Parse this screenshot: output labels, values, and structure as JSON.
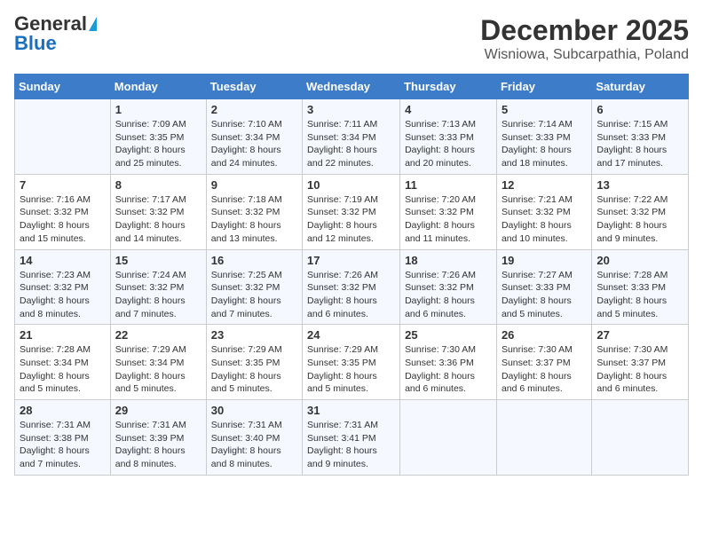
{
  "logo": {
    "line1": "General",
    "line2": "Blue"
  },
  "title": "December 2025",
  "subtitle": "Wisniowa, Subcarpathia, Poland",
  "days_of_week": [
    "Sunday",
    "Monday",
    "Tuesday",
    "Wednesday",
    "Thursday",
    "Friday",
    "Saturday"
  ],
  "weeks": [
    [
      {
        "day": "",
        "info": ""
      },
      {
        "day": "1",
        "info": "Sunrise: 7:09 AM\nSunset: 3:35 PM\nDaylight: 8 hours\nand 25 minutes."
      },
      {
        "day": "2",
        "info": "Sunrise: 7:10 AM\nSunset: 3:34 PM\nDaylight: 8 hours\nand 24 minutes."
      },
      {
        "day": "3",
        "info": "Sunrise: 7:11 AM\nSunset: 3:34 PM\nDaylight: 8 hours\nand 22 minutes."
      },
      {
        "day": "4",
        "info": "Sunrise: 7:13 AM\nSunset: 3:33 PM\nDaylight: 8 hours\nand 20 minutes."
      },
      {
        "day": "5",
        "info": "Sunrise: 7:14 AM\nSunset: 3:33 PM\nDaylight: 8 hours\nand 18 minutes."
      },
      {
        "day": "6",
        "info": "Sunrise: 7:15 AM\nSunset: 3:33 PM\nDaylight: 8 hours\nand 17 minutes."
      }
    ],
    [
      {
        "day": "7",
        "info": "Sunrise: 7:16 AM\nSunset: 3:32 PM\nDaylight: 8 hours\nand 15 minutes."
      },
      {
        "day": "8",
        "info": "Sunrise: 7:17 AM\nSunset: 3:32 PM\nDaylight: 8 hours\nand 14 minutes."
      },
      {
        "day": "9",
        "info": "Sunrise: 7:18 AM\nSunset: 3:32 PM\nDaylight: 8 hours\nand 13 minutes."
      },
      {
        "day": "10",
        "info": "Sunrise: 7:19 AM\nSunset: 3:32 PM\nDaylight: 8 hours\nand 12 minutes."
      },
      {
        "day": "11",
        "info": "Sunrise: 7:20 AM\nSunset: 3:32 PM\nDaylight: 8 hours\nand 11 minutes."
      },
      {
        "day": "12",
        "info": "Sunrise: 7:21 AM\nSunset: 3:32 PM\nDaylight: 8 hours\nand 10 minutes."
      },
      {
        "day": "13",
        "info": "Sunrise: 7:22 AM\nSunset: 3:32 PM\nDaylight: 8 hours\nand 9 minutes."
      }
    ],
    [
      {
        "day": "14",
        "info": "Sunrise: 7:23 AM\nSunset: 3:32 PM\nDaylight: 8 hours\nand 8 minutes."
      },
      {
        "day": "15",
        "info": "Sunrise: 7:24 AM\nSunset: 3:32 PM\nDaylight: 8 hours\nand 7 minutes."
      },
      {
        "day": "16",
        "info": "Sunrise: 7:25 AM\nSunset: 3:32 PM\nDaylight: 8 hours\nand 7 minutes."
      },
      {
        "day": "17",
        "info": "Sunrise: 7:26 AM\nSunset: 3:32 PM\nDaylight: 8 hours\nand 6 minutes."
      },
      {
        "day": "18",
        "info": "Sunrise: 7:26 AM\nSunset: 3:32 PM\nDaylight: 8 hours\nand 6 minutes."
      },
      {
        "day": "19",
        "info": "Sunrise: 7:27 AM\nSunset: 3:33 PM\nDaylight: 8 hours\nand 5 minutes."
      },
      {
        "day": "20",
        "info": "Sunrise: 7:28 AM\nSunset: 3:33 PM\nDaylight: 8 hours\nand 5 minutes."
      }
    ],
    [
      {
        "day": "21",
        "info": "Sunrise: 7:28 AM\nSunset: 3:34 PM\nDaylight: 8 hours\nand 5 minutes."
      },
      {
        "day": "22",
        "info": "Sunrise: 7:29 AM\nSunset: 3:34 PM\nDaylight: 8 hours\nand 5 minutes."
      },
      {
        "day": "23",
        "info": "Sunrise: 7:29 AM\nSunset: 3:35 PM\nDaylight: 8 hours\nand 5 minutes."
      },
      {
        "day": "24",
        "info": "Sunrise: 7:29 AM\nSunset: 3:35 PM\nDaylight: 8 hours\nand 5 minutes."
      },
      {
        "day": "25",
        "info": "Sunrise: 7:30 AM\nSunset: 3:36 PM\nDaylight: 8 hours\nand 6 minutes."
      },
      {
        "day": "26",
        "info": "Sunrise: 7:30 AM\nSunset: 3:37 PM\nDaylight: 8 hours\nand 6 minutes."
      },
      {
        "day": "27",
        "info": "Sunrise: 7:30 AM\nSunset: 3:37 PM\nDaylight: 8 hours\nand 6 minutes."
      }
    ],
    [
      {
        "day": "28",
        "info": "Sunrise: 7:31 AM\nSunset: 3:38 PM\nDaylight: 8 hours\nand 7 minutes."
      },
      {
        "day": "29",
        "info": "Sunrise: 7:31 AM\nSunset: 3:39 PM\nDaylight: 8 hours\nand 8 minutes."
      },
      {
        "day": "30",
        "info": "Sunrise: 7:31 AM\nSunset: 3:40 PM\nDaylight: 8 hours\nand 8 minutes."
      },
      {
        "day": "31",
        "info": "Sunrise: 7:31 AM\nSunset: 3:41 PM\nDaylight: 8 hours\nand 9 minutes."
      },
      {
        "day": "",
        "info": ""
      },
      {
        "day": "",
        "info": ""
      },
      {
        "day": "",
        "info": ""
      }
    ]
  ]
}
